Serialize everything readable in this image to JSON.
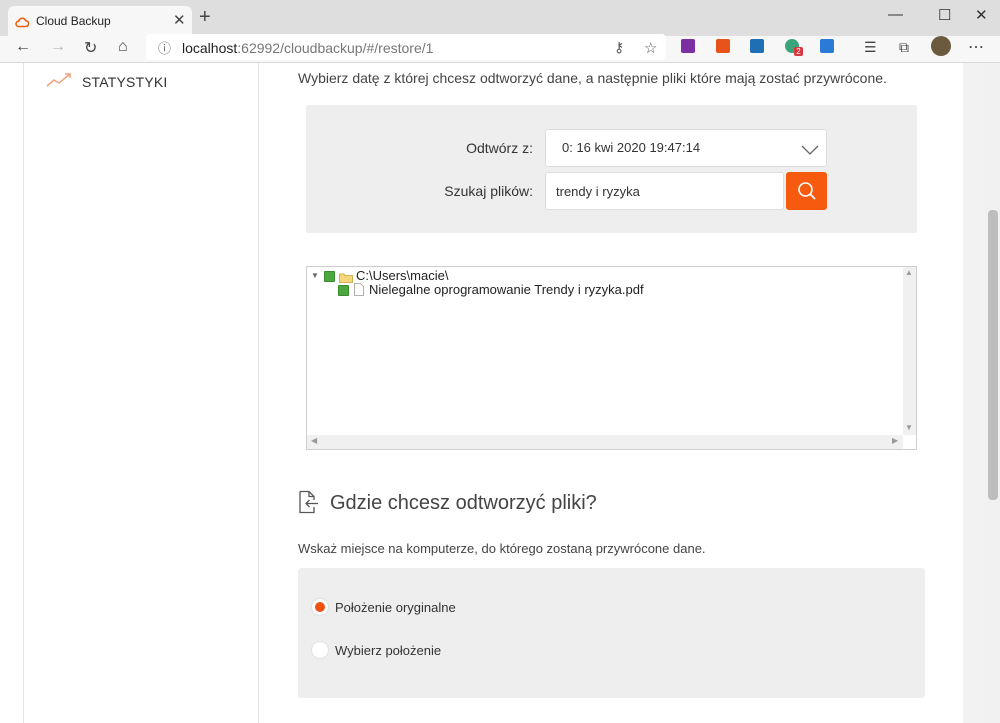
{
  "browser": {
    "tab_title": "Cloud Backup",
    "url_host": "localhost",
    "url_rest": ":62992/cloudbackup/#/restore/1",
    "ext_badge": "2"
  },
  "sidebar": {
    "items": [
      {
        "label": "STATYSTYKI",
        "icon": "trending-up-icon"
      }
    ]
  },
  "restore": {
    "intro": "Wybierz datę z której chcesz odtworzyć dane, a następnie pliki które mają zostać przywrócone.",
    "restore_from_label": "Odtwórz z:",
    "restore_from_value": "0: 16 kwi 2020 19:47:14",
    "search_label": "Szukaj plików:",
    "search_value": "trendy i ryzyka"
  },
  "tree": {
    "folder": "C:\\Users\\macie\\",
    "file": "Nielegalne oprogramowanie Trendy i ryzyka.pdf"
  },
  "destination": {
    "heading": "Gdzie chcesz odtworzyć pliki?",
    "description": "Wskaż miejsce na komputerze, do którego zostaną przywrócone dane.",
    "options": [
      {
        "label": "Położenie oryginalne",
        "selected": true
      },
      {
        "label": "Wybierz położenie",
        "selected": false
      }
    ]
  },
  "colors": {
    "accent": "#f55a0e",
    "check": "#4aa83c"
  }
}
